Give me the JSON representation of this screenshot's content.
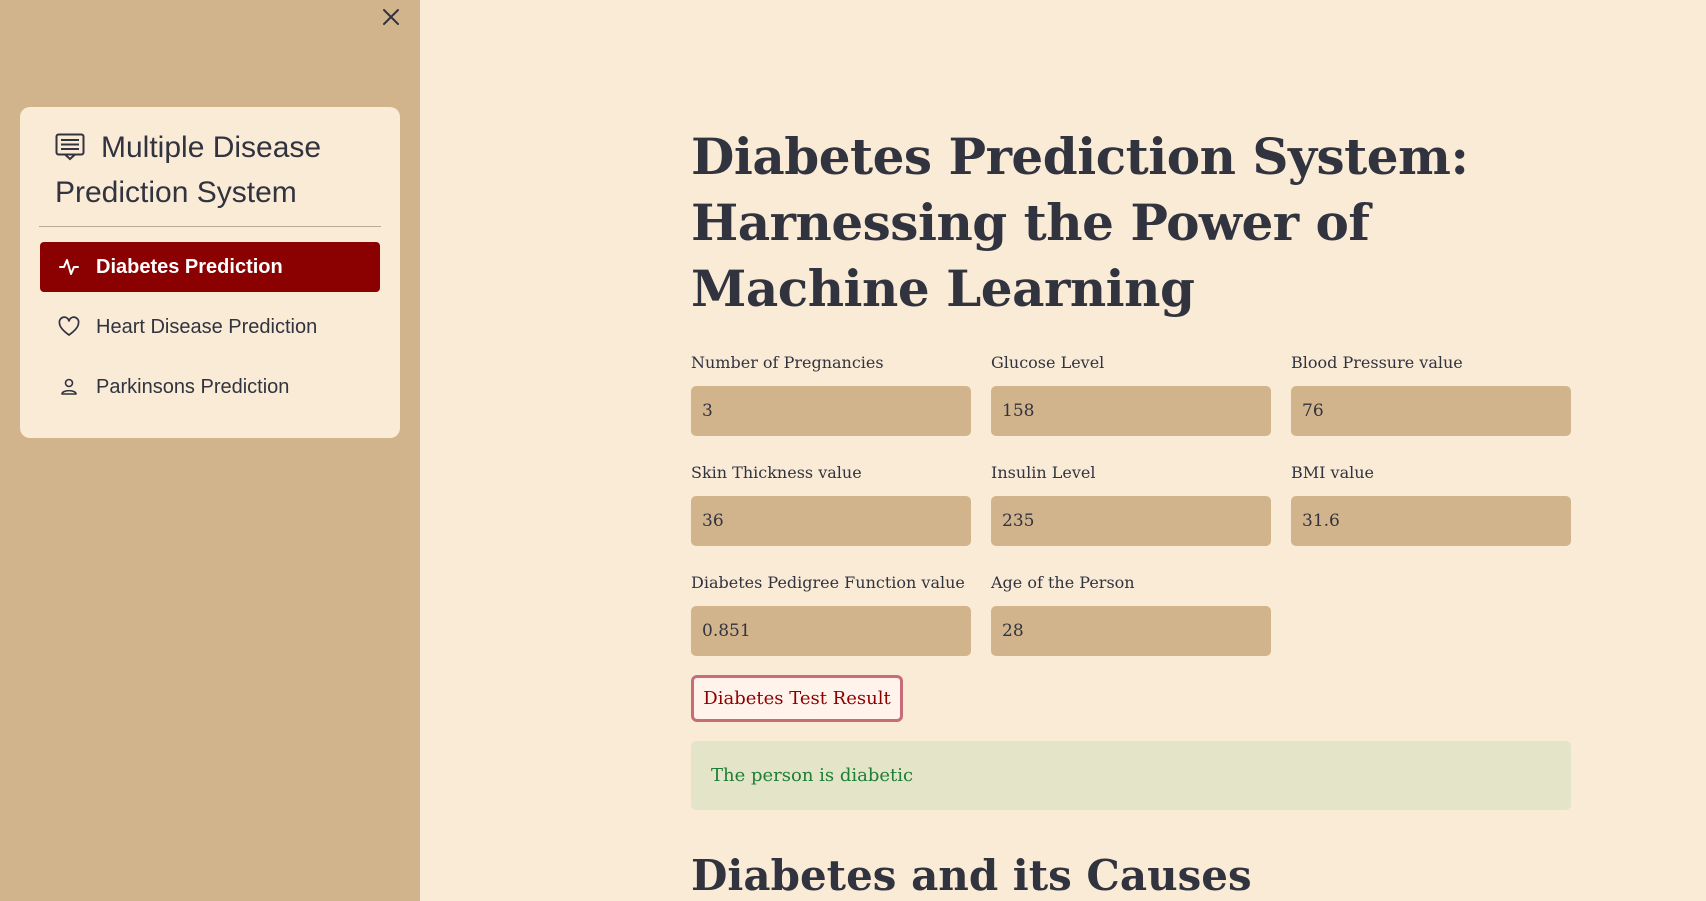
{
  "sidebar": {
    "close_icon": "close-icon",
    "menu": {
      "title": "Multiple Disease Prediction System",
      "title_icon": "menu-list-icon",
      "items": [
        {
          "label": "Diabetes Prediction",
          "icon": "activity-icon",
          "active": true
        },
        {
          "label": "Heart Disease Prediction",
          "icon": "heart-icon",
          "active": false
        },
        {
          "label": "Parkinsons Prediction",
          "icon": "person-icon",
          "active": false
        }
      ],
      "active_color": "#8B0000"
    }
  },
  "main": {
    "title": "Diabetes Prediction System: Harnessing the Power of Machine Learning",
    "fields": [
      {
        "label": "Number of Pregnancies",
        "value": "3"
      },
      {
        "label": "Glucose Level",
        "value": "158"
      },
      {
        "label": "Blood Pressure value",
        "value": "76"
      },
      {
        "label": "Skin Thickness value",
        "value": "36"
      },
      {
        "label": "Insulin Level",
        "value": "235"
      },
      {
        "label": "BMI value",
        "value": "31.6"
      },
      {
        "label": "Diabetes Pedigree Function value",
        "value": "0.851"
      },
      {
        "label": "Age of the Person",
        "value": "28"
      }
    ],
    "button_label": "Diabetes Test Result",
    "result_text": "The person is diabetic",
    "section_heading": "Diabetes and its Causes"
  },
  "colors": {
    "background": "#FAEBD7",
    "sidebar": "#D2B48C",
    "input": "#D2B48C",
    "accent": "#8B0000",
    "success_text": "#1E7E34",
    "success_bg": "#E3E4C8"
  }
}
